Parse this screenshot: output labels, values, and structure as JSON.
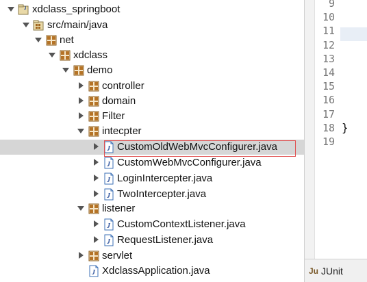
{
  "explorer": {
    "items": [
      {
        "label": "xdclass_springboot",
        "icon": "project-icon",
        "expanded": true
      },
      {
        "label": "src/main/java",
        "icon": "source-folder-icon",
        "expanded": true
      },
      {
        "label": "net",
        "icon": "package-icon",
        "expanded": true
      },
      {
        "label": "xdclass",
        "icon": "package-icon",
        "expanded": true
      },
      {
        "label": "demo",
        "icon": "package-icon",
        "expanded": true
      },
      {
        "label": "controller",
        "icon": "package-icon",
        "expanded": false
      },
      {
        "label": "domain",
        "icon": "package-icon",
        "expanded": false
      },
      {
        "label": "Filter",
        "icon": "package-icon",
        "expanded": false
      },
      {
        "label": "intecpter",
        "icon": "package-icon",
        "expanded": true
      },
      {
        "label": "CustomOldWebMvcConfigurer.java",
        "icon": "java-file-icon",
        "expanded": false,
        "selected": true
      },
      {
        "label": "CustomWebMvcConfigurer.java",
        "icon": "java-file-icon",
        "expanded": false
      },
      {
        "label": "LoginIntercepter.java",
        "icon": "java-file-icon",
        "expanded": false
      },
      {
        "label": "TwoIntercepter.java",
        "icon": "java-file-icon",
        "expanded": false
      },
      {
        "label": "listener",
        "icon": "package-icon",
        "expanded": true
      },
      {
        "label": "CustomContextListener.java",
        "icon": "java-file-icon",
        "expanded": false
      },
      {
        "label": "RequestListener.java",
        "icon": "java-file-icon",
        "expanded": false
      },
      {
        "label": "servlet",
        "icon": "package-icon",
        "expanded": false
      },
      {
        "label": "XdclassApplication.java",
        "icon": "java-file-icon",
        "expanded": false
      }
    ]
  },
  "editor": {
    "lines": [
      {
        "number": "9",
        "code": ""
      },
      {
        "number": "10",
        "code": ""
      },
      {
        "number": "11",
        "code": ""
      },
      {
        "number": "12",
        "code": ""
      },
      {
        "number": "13",
        "code": ""
      },
      {
        "number": "14",
        "code": ""
      },
      {
        "number": "15",
        "code": ""
      },
      {
        "number": "16",
        "code": ""
      },
      {
        "number": "17",
        "code": ""
      },
      {
        "number": "18",
        "code": "}"
      },
      {
        "number": "19",
        "code": ""
      }
    ]
  },
  "bottom_panel": {
    "tab_icon_text": "Ju",
    "tab_label": "JUnit"
  },
  "colors": {
    "selection": "#d6d6d6",
    "highlight_border": "#e05050",
    "package_icon": "#a0661e",
    "java_file_icon": "#3b6fb6"
  }
}
